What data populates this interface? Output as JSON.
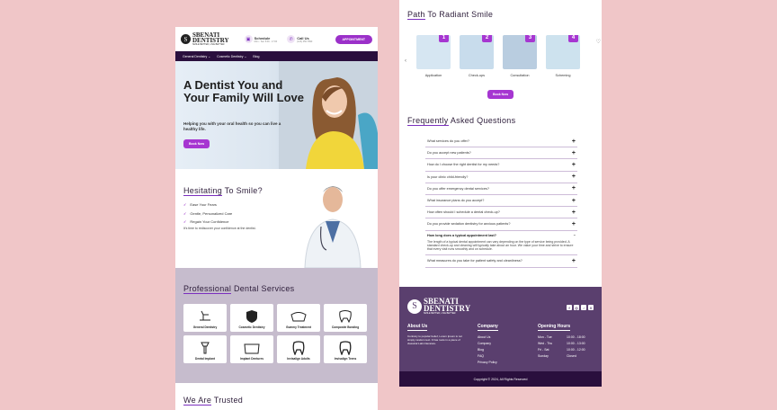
{
  "brand": {
    "name_line1": "SBENATI",
    "name_line2": "DENTISTRY",
    "tagline": "SMILE BETTER, LIVE BETTER."
  },
  "header": {
    "schedule_label": "Schedule",
    "schedule_detail": "Mon - Sat: 8:00 - 17:00",
    "call_label": "Call Us",
    "call_detail": "(123) 456-7890",
    "appointment_button": "APPOINTMENT"
  },
  "nav": {
    "items": [
      "General Dentistry",
      "Cosmetic Dentistry",
      "Blog"
    ]
  },
  "hero": {
    "title": "A Dentist You and Your Family Will Love",
    "subtitle": "Helping you with your oral health so you can live a healthy life.",
    "button": "Book Now"
  },
  "hesitating": {
    "title_underlined": "Hesitating",
    "title_rest": " To Smile?",
    "checks": [
      "Ease Your Fears",
      "Gentle, Personalized Care",
      "Regain Your Confidence"
    ],
    "note": "It's time to rediscover your confidence at the dentist."
  },
  "services": {
    "title_underlined": "Professional",
    "title_rest": " Dental Services",
    "items": [
      "General Dentistry",
      "Cosmetic Dentistry",
      "Gummy Treatment",
      "Composite Bonding",
      "Dental Implant",
      "Implant Dentures",
      "Invisalign Adults",
      "Invisalign Teens"
    ]
  },
  "trusted": {
    "title_underlined": "We Are",
    "title_rest": " Trusted"
  },
  "path": {
    "title_underlined": "Path",
    "title_rest": " To Radiant Smile",
    "steps": [
      {
        "num": "1",
        "label": "Application"
      },
      {
        "num": "2",
        "label": "Check-ups"
      },
      {
        "num": "3",
        "label": "Consultation"
      },
      {
        "num": "4",
        "label": "Scheming"
      }
    ],
    "button": "Book Now"
  },
  "faq": {
    "title_underlined": "Frequently",
    "title_rest": " Asked Questions",
    "questions": [
      "What services do you offer?",
      "Do you accept new patients?",
      "How do I choose the right dentist for my needs?",
      "Is your clinic child-friendly?",
      "Do you offer emergency dental services?",
      "What insurance plans do you accept?",
      "How often should I schedule a dental check-up?",
      "Do you provide sedation dentistry for anxious patients?"
    ],
    "open_question": "How long does a typical appointment last?",
    "open_answer": "The length of a typical dental appointment can vary depending on the type of service being provided. A standard check-up and cleaning will typically take about an hour. We value your time and strive to ensure that every visit runs smoothly and on schedule.",
    "last_question": "What measures do you take for patient safety and cleanliness?"
  },
  "footer": {
    "about_title": "About Us",
    "about_text": "Contrary to popular belief, Lorem Ipsum is not simply random text. It has roots in a piece of classical Latin literature.",
    "company_title": "Company",
    "company_links": [
      "About Us",
      "Company",
      "Blog",
      "FAQ",
      "Privacy Policy"
    ],
    "hours_title": "Opening Hours",
    "hours": [
      {
        "day": "Mon - Tue",
        "time": "10:00 - 18:00"
      },
      {
        "day": "Wed - Thu",
        "time": "10:00 - 13:00"
      },
      {
        "day": "Fri - Sat",
        "time": "10:00 - 12:00"
      },
      {
        "day": "Sunday",
        "time": "Closed"
      }
    ],
    "copyright": "Copyright © 2024, All Rights Reserved"
  },
  "social": [
    "f",
    "◎",
    "♪",
    "X"
  ],
  "colors": {
    "accent": "#a636d1",
    "dark": "#2a0f3d",
    "footer": "#5a3f6e",
    "services_bg": "#c6bccd",
    "page_bg": "#f0c6c8"
  }
}
